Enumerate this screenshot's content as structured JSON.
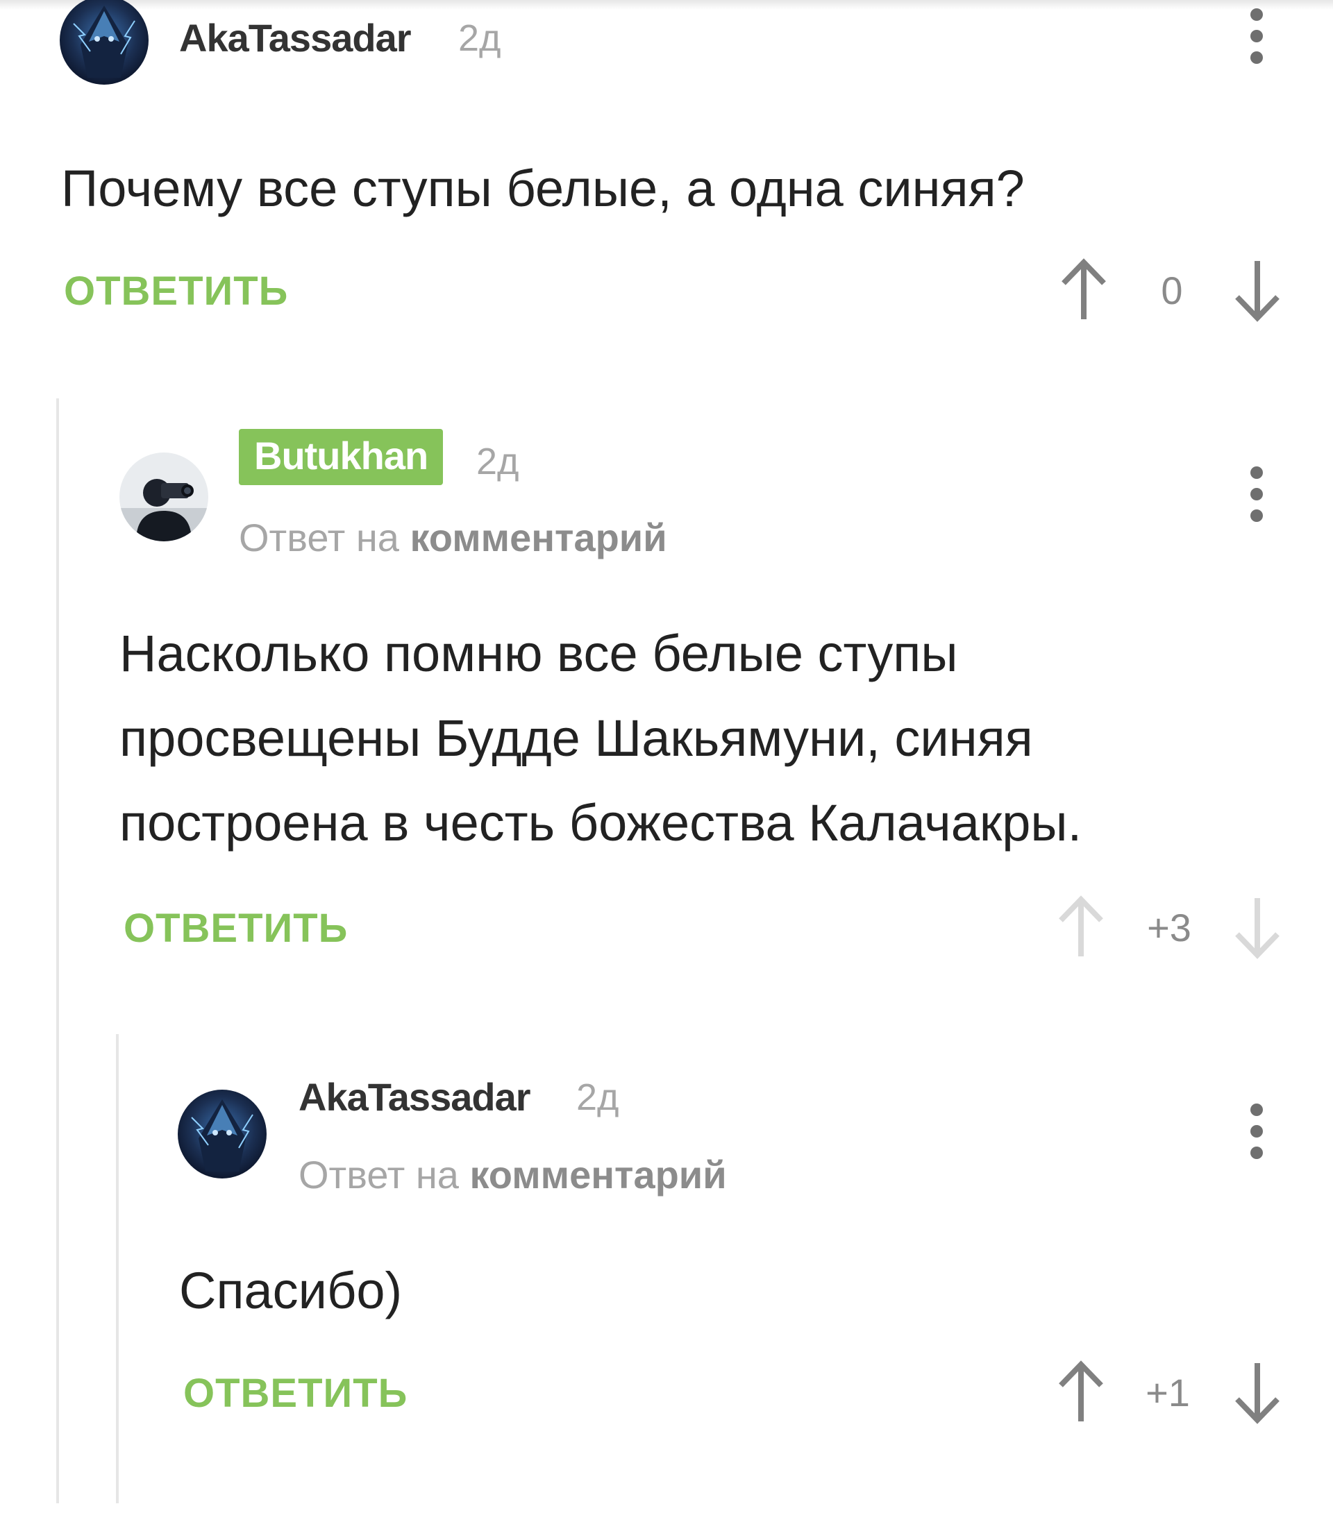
{
  "colors": {
    "accent": "#86c35a",
    "muted": "#a6a6a6",
    "text": "#222222",
    "thread_line": "#e6e6e6"
  },
  "comments": [
    {
      "username": "AkaTassadar",
      "time": "2д",
      "text": "Почему все ступы белые, а одна синяя?",
      "reply_label": "ОТВЕТИТЬ",
      "score": "0",
      "upvote_icon": "arrow-up-icon",
      "downvote_icon": "arrow-down-icon",
      "menu_icon": "more-vertical-icon"
    },
    {
      "username": "Butukhan",
      "time": "2д",
      "reply_to_prefix": "Ответ на",
      "reply_to_link": "комментарий",
      "text_lines": [
        "Насколько помню все белые ступы",
        "просвещены Будде Шакьямуни, синяя",
        "построена в честь божества Калачакры."
      ],
      "reply_label": "ОТВЕТИТЬ",
      "score": "+3",
      "upvote_icon": "arrow-up-icon",
      "downvote_icon": "arrow-down-icon",
      "menu_icon": "more-vertical-icon"
    },
    {
      "username": "AkaTassadar",
      "time": "2д",
      "reply_to_prefix": "Ответ на",
      "reply_to_link": "комментарий",
      "text": "Спасибо)",
      "reply_label": "ОТВЕТИТЬ",
      "score": "+1",
      "upvote_icon": "arrow-up-icon",
      "downvote_icon": "arrow-down-icon",
      "menu_icon": "more-vertical-icon"
    }
  ]
}
